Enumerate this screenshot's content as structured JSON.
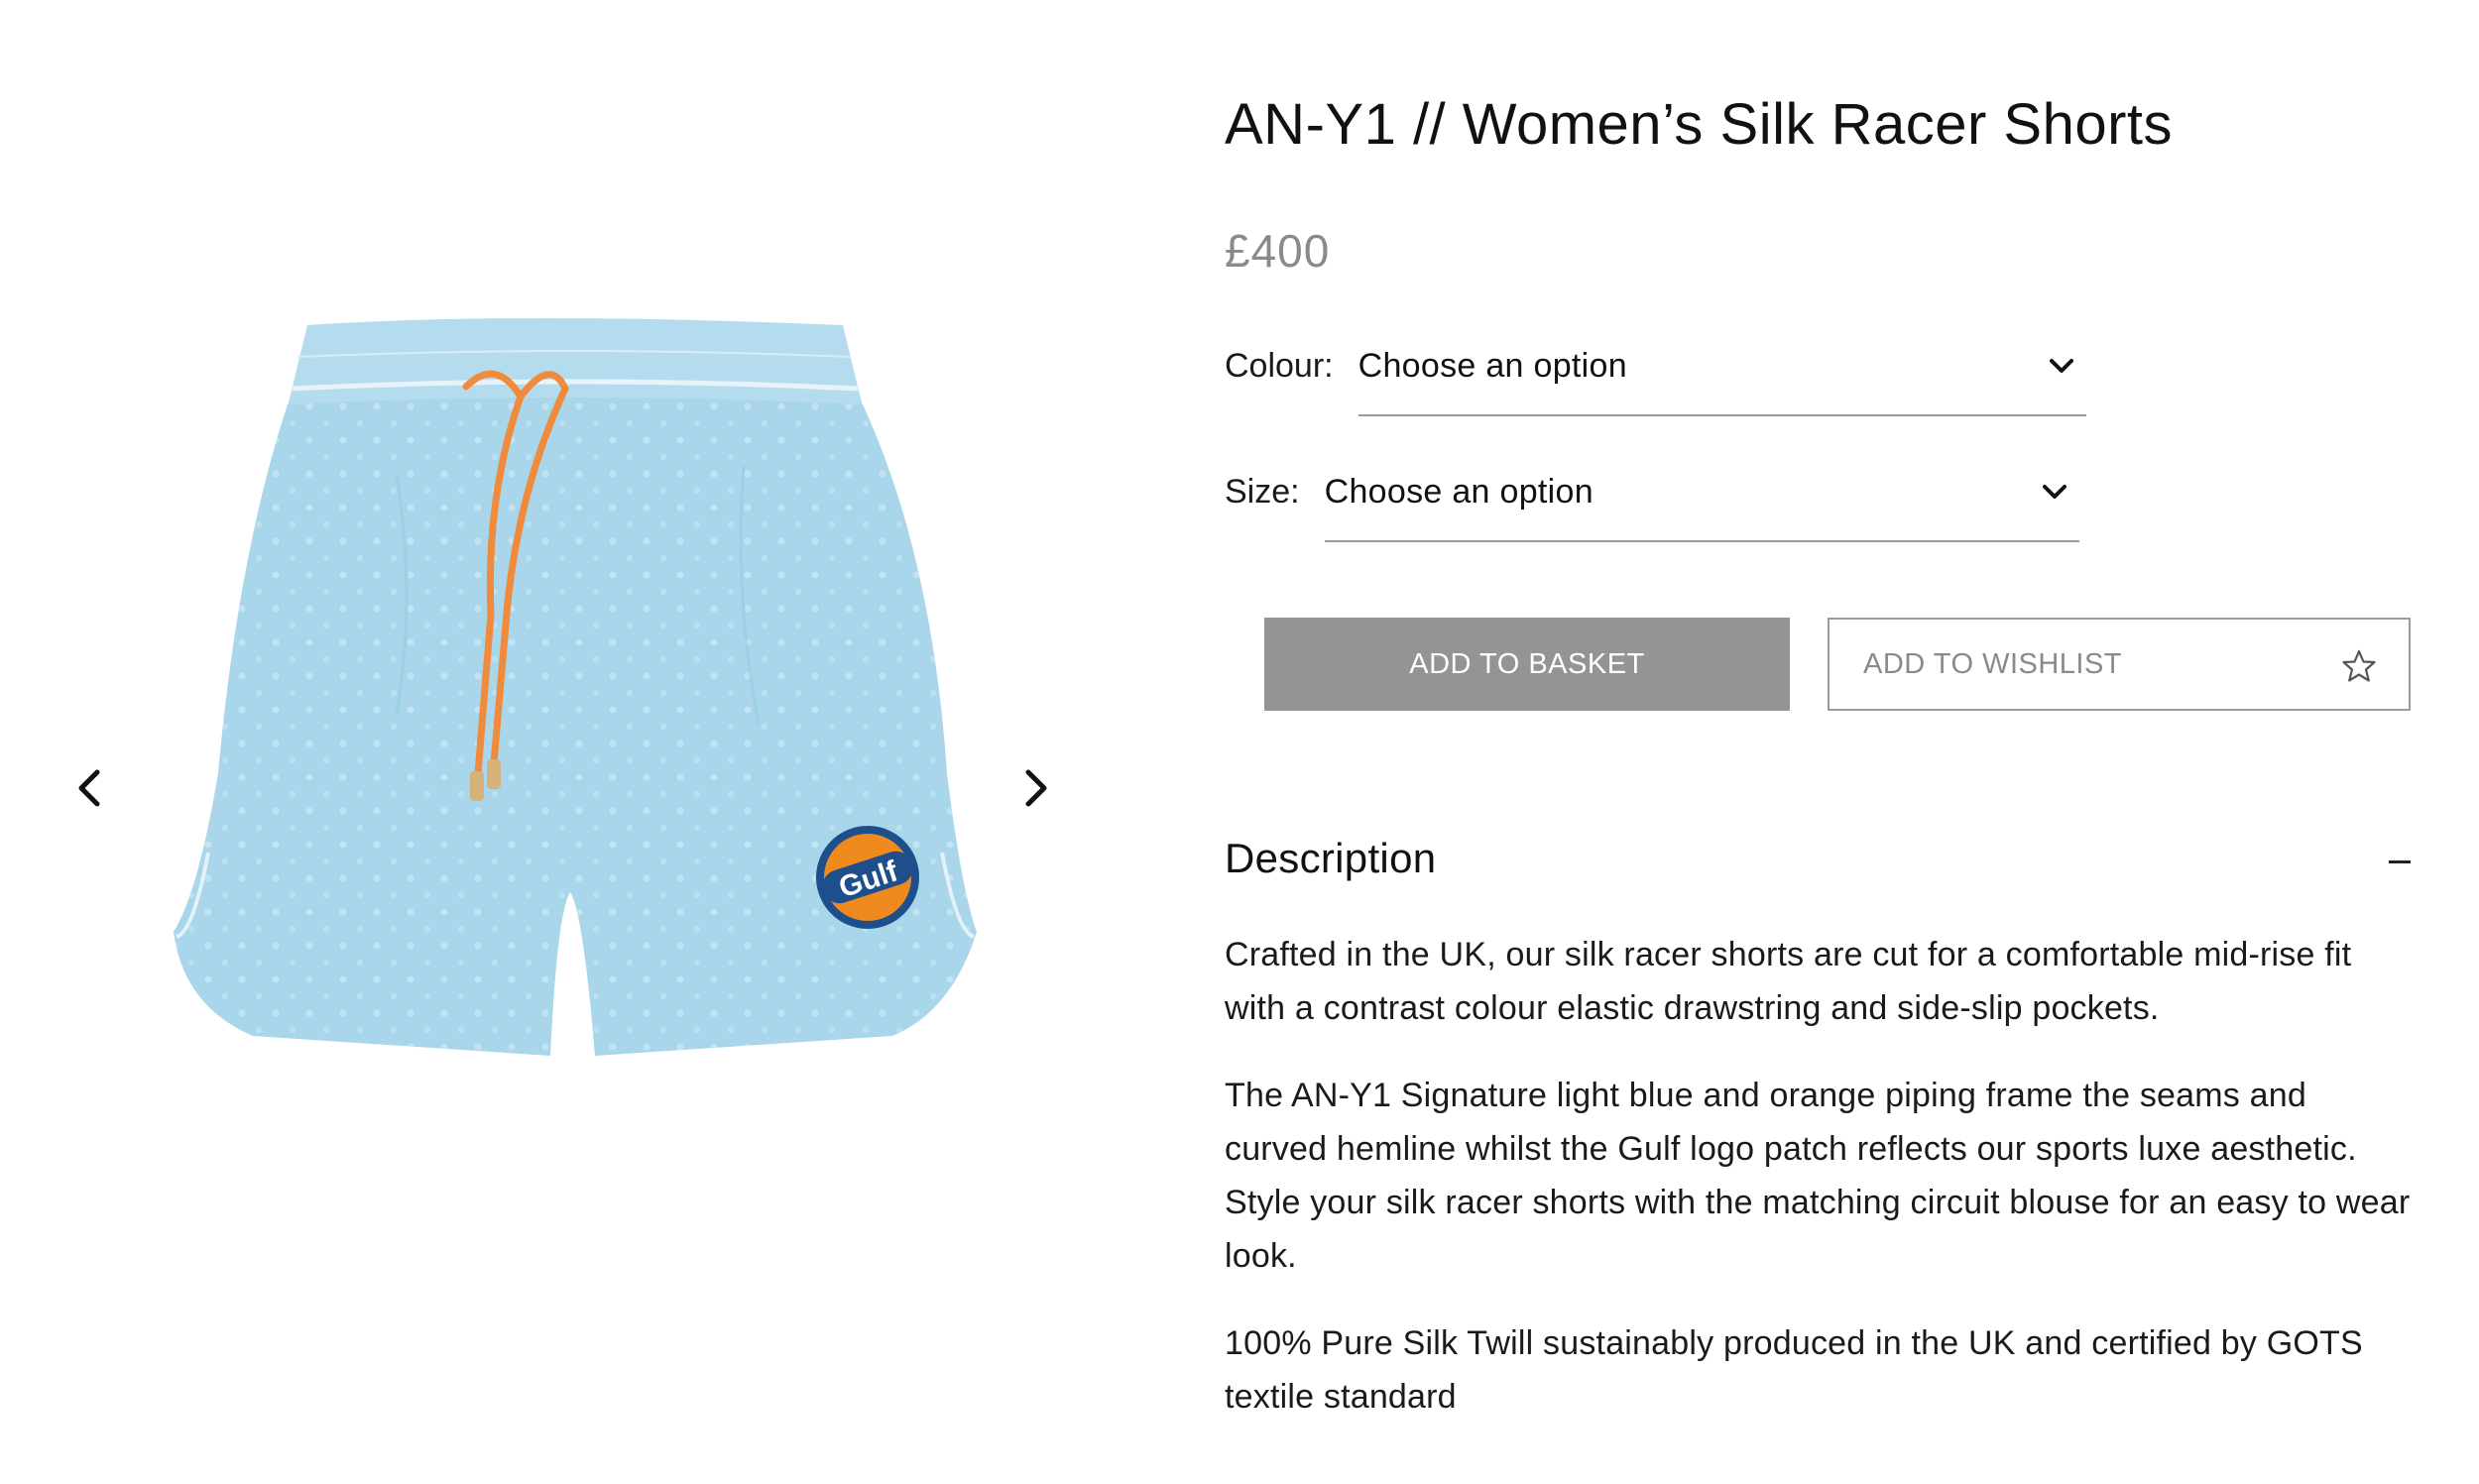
{
  "product": {
    "title": "AN-Y1 // Women’s Silk Racer Shorts",
    "price": "£400",
    "image_logo_text": "Gulf"
  },
  "options": {
    "colour": {
      "label": "Colour:",
      "value": "Choose an option"
    },
    "size": {
      "label": "Size:",
      "value": "Choose an option"
    }
  },
  "actions": {
    "add_to_basket": "ADD TO BASKET",
    "add_to_wishlist": "ADD TO WISHLIST"
  },
  "description": {
    "title": "Description",
    "paragraphs": [
      "Crafted in the UK, our silk racer shorts are cut for a comfortable mid-rise fit with a contrast colour elastic drawstring and side-slip pockets.",
      "The AN-Y1 Signature light blue and orange piping frame the seams and curved hemline whilst the Gulf  logo patch reflects our sports luxe aesthetic. Style your silk racer shorts with the matching circuit blouse for an easy to wear look.",
      "100% Pure Silk Twill sustainably produced in the UK and certified by GOTS textile standard"
    ]
  },
  "icons": {
    "prev": "chevron-left-icon",
    "next": "chevron-right-icon",
    "dropdown": "chevron-down-icon",
    "wishlist": "star-icon",
    "collapse": "minus-icon"
  },
  "colors": {
    "shorts": "#a9d6ea",
    "drawstring": "#f08a3c",
    "button": "#929496",
    "price": "#8a8a8a"
  }
}
